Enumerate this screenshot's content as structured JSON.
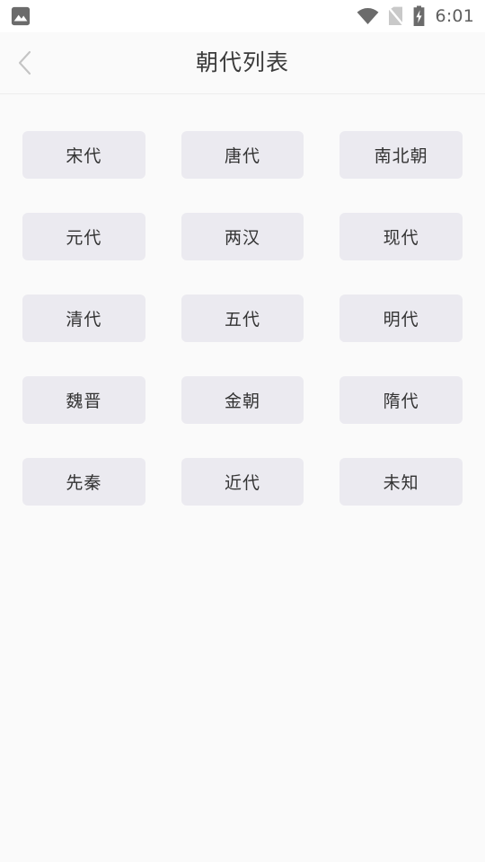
{
  "status_bar": {
    "notification_icon": "photo-icon",
    "wifi_icon": "wifi-icon",
    "sim_icon": "no-sim-icon",
    "battery_icon": "battery-charging-icon",
    "time": "6:01",
    "background_color": "#ffffff",
    "icon_color": "#6b6b6b"
  },
  "app_bar": {
    "back_icon": "chevron-left-icon",
    "title": "朝代列表",
    "background_color": "#fafafa",
    "title_color": "#3b3b3b",
    "divider_color": "#ededed"
  },
  "content": {
    "background_color": "#fafafa",
    "chip_background_color": "#ebeaf0",
    "chip_text_color": "#333333",
    "columns": 3,
    "rows": [
      [
        {
          "label": "宋代"
        },
        {
          "label": "唐代"
        },
        {
          "label": "南北朝"
        }
      ],
      [
        {
          "label": "元代"
        },
        {
          "label": "两汉"
        },
        {
          "label": "现代"
        }
      ],
      [
        {
          "label": "清代"
        },
        {
          "label": "五代"
        },
        {
          "label": "明代"
        }
      ],
      [
        {
          "label": "魏晋"
        },
        {
          "label": "金朝"
        },
        {
          "label": "隋代"
        }
      ],
      [
        {
          "label": "先秦"
        },
        {
          "label": "近代"
        },
        {
          "label": "未知"
        }
      ]
    ]
  }
}
